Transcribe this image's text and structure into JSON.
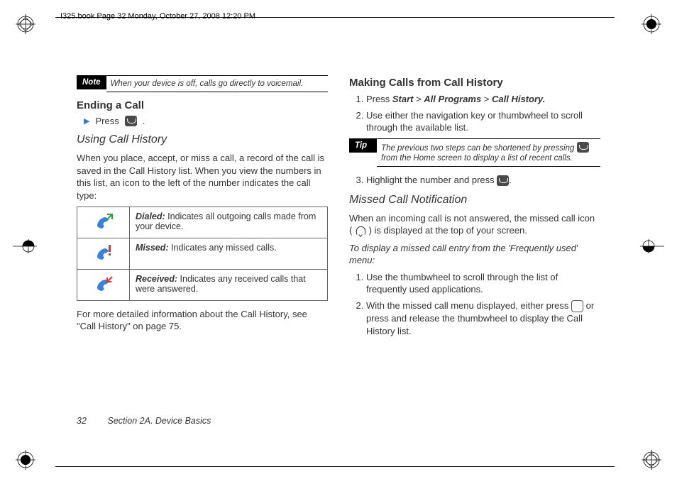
{
  "header": "I325.book  Page 32  Monday, October 27, 2008  12:20 PM",
  "note": {
    "label": "Note",
    "text": "When your device is off, calls go directly to voicemail."
  },
  "ending": {
    "title": "Ending a Call",
    "step": "Press "
  },
  "using": {
    "title": "Using Call History",
    "intro": "When you place, accept, or miss a call, a record of the call is saved in the Call History list. When you view the numbers in this list, an icon to the left of the number indicates the call type:",
    "rows": [
      {
        "label": "Dialed:",
        "desc": " Indicates all outgoing calls made from your device."
      },
      {
        "label": "Missed:",
        "desc": " Indicates any missed calls."
      },
      {
        "label": "Received:",
        "desc": " Indicates any received calls that were answered."
      }
    ],
    "after": "For more detailed information about the Call History, see \"Call History\" on page 75."
  },
  "making": {
    "title": "Making Calls from Call History",
    "step1_pre": "Press ",
    "step1_b1": "Start",
    "step1_g1": " > ",
    "step1_b2": "All Programs",
    "step1_g2": " > ",
    "step1_b3": "Call History.",
    "step2": "Use either the navigation key or thumbwheel to scroll through the available list.",
    "step3_pre": "Highlight the number and press ",
    "step3_post": "."
  },
  "tip": {
    "label": "Tip",
    "t1": "The previous two steps can be shortened by pressing ",
    "t2": " from the Home screen to display a list of recent calls."
  },
  "missed": {
    "title": "Missed Call Notification",
    "p_pre": "When an incoming call is not answered, the missed call icon ( ",
    "p_post": " ) is displayed at the top of your screen.",
    "sub": "To display a missed call entry from the 'Frequently used' menu:",
    "s1": "Use the thumbwheel to scroll through the list of frequently used applications.",
    "s2_pre": "With the missed call menu displayed, either press ",
    "s2_post": " or press and release the thumbwheel to display the Call History list."
  },
  "footer": {
    "page": "32",
    "section": "Section 2A. Device Basics"
  }
}
